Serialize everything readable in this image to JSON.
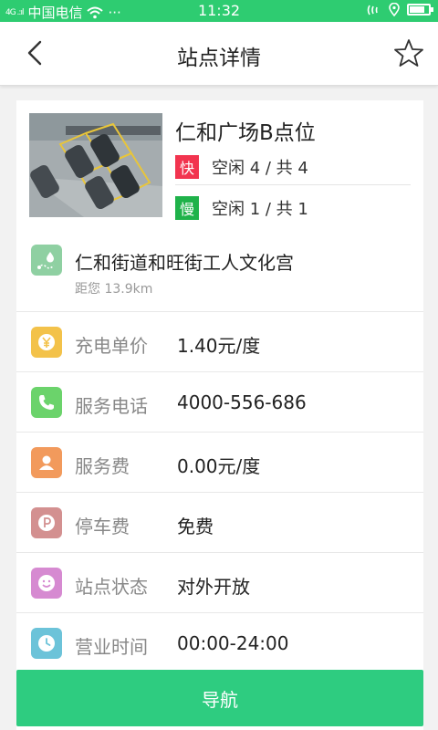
{
  "status_bar": {
    "signal": "4G .:ıl",
    "carrier": "中国电信",
    "extras": "···",
    "time": "11:32"
  },
  "header": {
    "title": "站点详情",
    "back_icon": "chevron-left-icon",
    "favorite_icon": "star-outline-icon"
  },
  "station": {
    "name": "仁和广场B点位",
    "fast_badge": "快",
    "fast_text": "空闲 4 / 共 4",
    "slow_badge": "慢",
    "slow_text": "空闲 1 / 共 1",
    "fast_color": "#f2344f",
    "slow_color": "#1fb24a"
  },
  "address": {
    "text": "仁和街道和旺街工人文化宫",
    "distance": "距您 13.9km"
  },
  "info_rows": [
    {
      "label": "充电单价",
      "value": "1.40元/度",
      "icon": "yen-icon",
      "color": "#f3c24a"
    },
    {
      "label": "服务电话",
      "value": "4000-556-686",
      "icon": "phone-icon",
      "color": "#6bd36b"
    },
    {
      "label": "服务费",
      "value": "0.00元/度",
      "icon": "person-icon",
      "color": "#f29a5c"
    },
    {
      "label": "停车费",
      "value": "免费",
      "icon": "parking-icon",
      "color": "#d39090"
    },
    {
      "label": "站点状态",
      "value": "对外开放",
      "icon": "smile-icon",
      "color": "#d68ad1"
    },
    {
      "label": "营业时间",
      "value": "00:00-24:00",
      "icon": "clock-icon",
      "color": "#6cc3d9"
    }
  ],
  "footer": {
    "navigate_label": "导航"
  },
  "colors": {
    "accent": "#2ecc71",
    "button": "#2ecc80"
  }
}
